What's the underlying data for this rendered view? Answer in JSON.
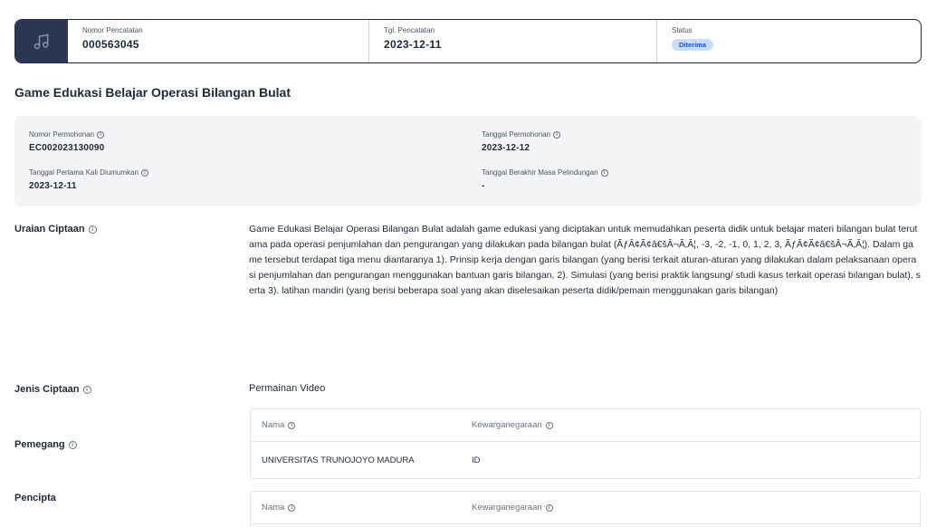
{
  "summary": {
    "icon": "music-note-icon",
    "nomor_label": "Nomor Pencatatan",
    "nomor_value": "000563045",
    "tgl_label": "Tgl. Pencatatan",
    "tgl_value": "2023-12-11",
    "status_label": "Status",
    "status_value": "Diterima"
  },
  "title": "Game Edukasi Belajar Operasi Bilangan Bulat",
  "info": {
    "nomor_permohonan_label": "Nomor Permohonan",
    "nomor_permohonan_value": "EC002023130090",
    "tanggal_permohonan_label": "Tanggal Permohonan",
    "tanggal_permohonan_value": "2023-12-12",
    "tanggal_umum_label": "Tanggal Pertama Kali Diumumkan",
    "tanggal_umum_value": "2023-12-11",
    "tanggal_akhir_label": "Tanggal Berakhir Masa Pelindungan",
    "tanggal_akhir_value": "-"
  },
  "uraian": {
    "label": "Uraian Ciptaan",
    "text": "Game Edukasi Belajar Operasi Bilangan Bulat adalah game edukasi yang diciptakan untuk memudahkan peserta didik untuk belajar materi bilangan bulat terutama pada operasi penjumlahan dan pengurangan yang dilakukan pada bilangan bulat (ÃƒÂ¢Ã¢â€šÂ¬Ã‚Â¦, -3, -2, -1, 0, 1, 2, 3, ÃƒÂ¢Ã¢â€šÂ¬Ã‚Â¦). Dalam game tersebut terdapat tiga menu diantaranya 1). Prinsip kerja dengan garis bilangan (yang berisi terkait aturan-aturan yang dilakukan dalam pelaksanaan operasi penjumlahan dan pengurangan menggunakan bantuan garis bilangan, 2). Simulasi (yang berisi praktik langsung/ studi kasus terkait operasi bilangan bulat), serta 3). latihan mandiri (yang berisi beberapa soal yang akan diselesaikan peserta didik/pemain menggunakan garis bilangan)"
  },
  "jenis": {
    "label": "Jenis Ciptaan",
    "value": "Permainan Video"
  },
  "pemegang": {
    "label": "Pemegang",
    "col_nama": "Nama",
    "col_warga": "Kewarganegaraan",
    "rows": [
      {
        "nama": "UNIVERSITAS TRUNOJOYO MADURA",
        "warga": "ID"
      }
    ]
  },
  "pencipta": {
    "label": "Pencipta",
    "col_nama": "Nama",
    "col_warga": "Kewarganegaraan"
  },
  "colors": {
    "icon_bg": "#2b3654",
    "badge_bg": "#c9ddfb",
    "badge_text": "#1d4ed8"
  }
}
